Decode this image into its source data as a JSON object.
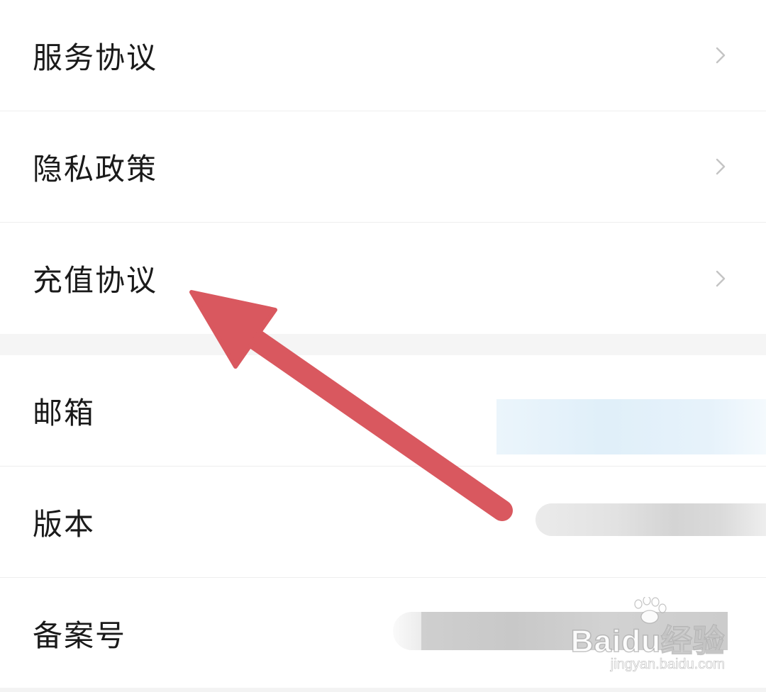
{
  "settings": {
    "legal": [
      {
        "label": "服务协议"
      },
      {
        "label": "隐私政策"
      },
      {
        "label": "充值协议"
      }
    ],
    "info": [
      {
        "label": "邮箱"
      },
      {
        "label": "版本"
      },
      {
        "label": "备案号"
      }
    ]
  },
  "watermark": {
    "logo": "Baidu经验",
    "url": "jingyan.baidu.com"
  },
  "colors": {
    "arrow": "#d9585f",
    "chevron": "#c4c4c4",
    "text": "#1a1a1a"
  }
}
